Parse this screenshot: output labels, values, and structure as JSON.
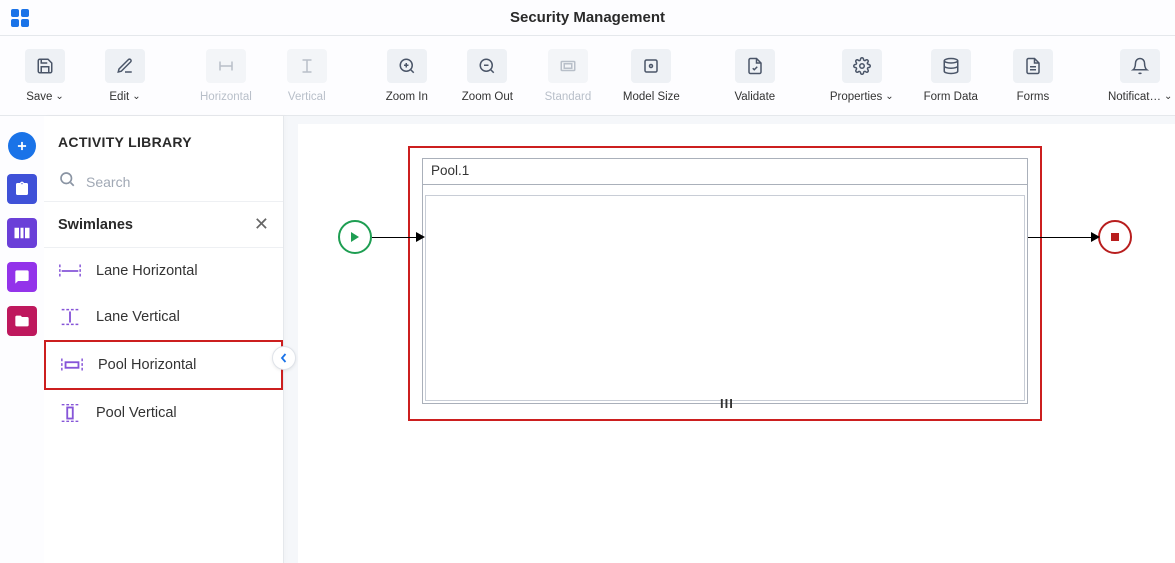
{
  "header": {
    "title": "Security Management"
  },
  "toolbar": {
    "save": "Save",
    "edit": "Edit",
    "horizontal": "Horizontal",
    "vertical": "Vertical",
    "zoomIn": "Zoom In",
    "zoomOut": "Zoom Out",
    "standard": "Standard",
    "modelSize": "Model Size",
    "validate": "Validate",
    "properties": "Properties",
    "formData": "Form Data",
    "forms": "Forms",
    "notifications": "Notificat…"
  },
  "sidebar": {
    "title": "ACTIVITY LIBRARY",
    "searchPlaceholder": "Search",
    "category": "Swimlanes",
    "items": [
      {
        "label": "Lane Horizontal"
      },
      {
        "label": "Lane Vertical"
      },
      {
        "label": "Pool Horizontal"
      },
      {
        "label": "Pool Vertical"
      }
    ]
  },
  "canvas": {
    "poolLabel": "Pool.1"
  }
}
